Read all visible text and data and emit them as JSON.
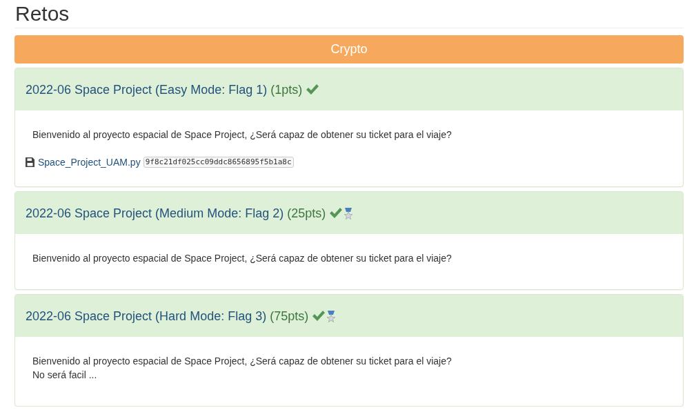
{
  "page": {
    "title": "Retos"
  },
  "category": {
    "label": "Crypto"
  },
  "challenges": [
    {
      "title": "2022-06 Space Project (Easy Mode: Flag 1)",
      "points": "(1pts)",
      "solved": true,
      "medal": false,
      "description": [
        "Bienvenido al proyecto espacial de Space Project, ¿Será capaz de obtener su ticket para el viaje?"
      ],
      "files": [
        {
          "name": "Space_Project_UAM.py",
          "hash": "9f8c21df025cc09ddc8656895f5b1a8c"
        }
      ]
    },
    {
      "title": "2022-06 Space Project (Medium Mode: Flag 2)",
      "points": "(25pts)",
      "solved": true,
      "medal": true,
      "description": [
        "Bienvenido al proyecto espacial de Space Project, ¿Será capaz de obtener su ticket para el viaje?"
      ]
    },
    {
      "title": "2022-06 Space Project (Hard Mode: Flag 3)",
      "points": "(75pts)",
      "solved": true,
      "medal": true,
      "description": [
        "Bienvenido al proyecto espacial de Space Project, ¿Será capaz de obtener su ticket para el viaje?",
        "No será facil ..."
      ]
    }
  ]
}
